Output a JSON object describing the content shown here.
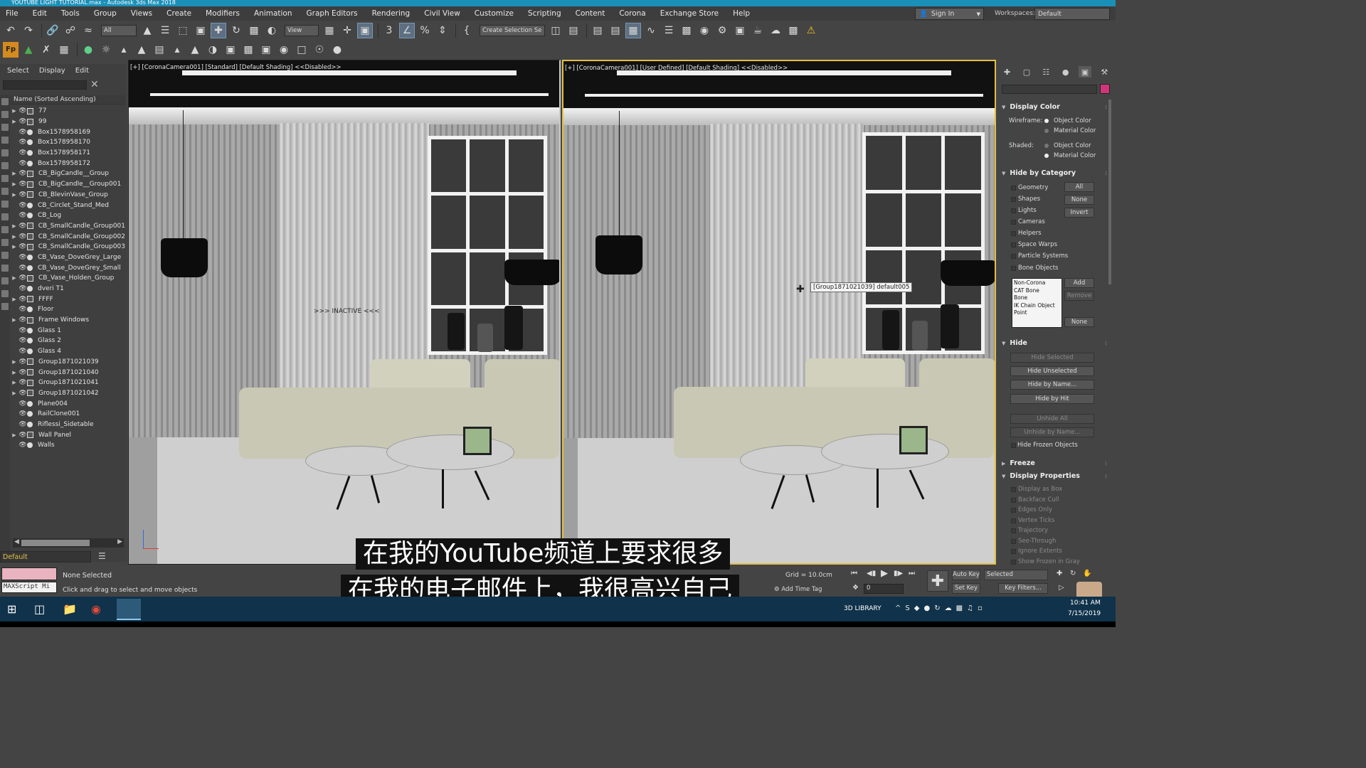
{
  "window": {
    "title": "YOUTUBE LIGHT TUTORIAL.max - Autodesk 3ds Max 2018"
  },
  "menu": [
    "File",
    "Edit",
    "Tools",
    "Group",
    "Views",
    "Create",
    "Modifiers",
    "Animation",
    "Graph Editors",
    "Rendering",
    "Civil View",
    "Customize",
    "Scripting",
    "Content",
    "Corona",
    "Exchange Store",
    "Help"
  ],
  "account": {
    "signin": "Sign In",
    "workspaces_label": "Workspaces:",
    "workspace": "Default"
  },
  "toolbar": {
    "filter": "All",
    "refcoord": "View",
    "selection_set": "Create Selection Se"
  },
  "explorer": {
    "tabs": [
      "Select",
      "Display",
      "Edit"
    ],
    "header": "Name (Sorted Ascending)",
    "items": [
      {
        "name": "77",
        "group": true
      },
      {
        "name": "99",
        "group": true
      },
      {
        "name": "Box1578958169",
        "group": false
      },
      {
        "name": "Box1578958170",
        "group": false
      },
      {
        "name": "Box1578958171",
        "group": false
      },
      {
        "name": "Box1578958172",
        "group": false
      },
      {
        "name": "CB_BigCandle__Group",
        "group": true
      },
      {
        "name": "CB_BigCandle__Group001",
        "group": true
      },
      {
        "name": "CB_BlevinVase_Group",
        "group": true
      },
      {
        "name": "CB_Circlet_Stand_Med",
        "group": false
      },
      {
        "name": "CB_Log",
        "group": false
      },
      {
        "name": "CB_SmallCandle_Group001",
        "group": true
      },
      {
        "name": "CB_SmallCandle_Group002",
        "group": true
      },
      {
        "name": "CB_SmallCandle_Group003",
        "group": true
      },
      {
        "name": "CB_Vase_DoveGrey_Large",
        "group": false
      },
      {
        "name": "CB_Vase_DoveGrey_Small",
        "group": false
      },
      {
        "name": "CB_Vase_Holden_Group",
        "group": true
      },
      {
        "name": "dveri T1",
        "group": false
      },
      {
        "name": "FFFF",
        "group": true
      },
      {
        "name": "Floor",
        "group": false
      },
      {
        "name": "Frame Windows",
        "group": true
      },
      {
        "name": "Glass 1",
        "group": false
      },
      {
        "name": "Glass 2",
        "group": false
      },
      {
        "name": "Glass 4",
        "group": false
      },
      {
        "name": "Group1871021039",
        "group": true
      },
      {
        "name": "Group1871021040",
        "group": true
      },
      {
        "name": "Group1871021041",
        "group": true
      },
      {
        "name": "Group1871021042",
        "group": true
      },
      {
        "name": "Plane004",
        "group": false
      },
      {
        "name": "RailClone001",
        "group": false
      },
      {
        "name": "Riflessi_Sidetable",
        "group": false
      },
      {
        "name": "Wall Panel",
        "group": true
      },
      {
        "name": "Walls",
        "group": false
      }
    ],
    "layer": "Default"
  },
  "viewports": {
    "left_label": "[+] [CoronaCamera001] [Standard] [Default Shading] <<Disabled>>",
    "right_label": "[+] [CoronaCamera001] [User Defined] [Default Shading] <<Disabled>>",
    "inactive": ">>> INACTIVE <<<",
    "tooltip": "[Group1871021039] default005"
  },
  "command_panel": {
    "display_color": {
      "title": "Display Color",
      "wireframe_label": "Wireframe:",
      "shaded_label": "Shaded:",
      "object_color": "Object Color",
      "material_color": "Material Color",
      "wireframe_selected": "Object Color",
      "shaded_selected": "Material Color"
    },
    "hide_by_category": {
      "title": "Hide by Category",
      "items": [
        "Geometry",
        "Shapes",
        "Lights",
        "Cameras",
        "Helpers",
        "Space Warps",
        "Particle Systems",
        "Bone Objects"
      ],
      "buttons": [
        "All",
        "None",
        "Invert"
      ],
      "list": [
        "Non-Corona",
        "CAT Bone",
        "Bone",
        "IK Chain Object",
        "Point"
      ],
      "list_buttons": [
        "Add",
        "Remove",
        "None"
      ]
    },
    "hide": {
      "title": "Hide",
      "buttons": [
        "Hide Selected",
        "Hide Unselected",
        "Hide by Name...",
        "Hide by Hit",
        "Unhide All",
        "Unhide by Name..."
      ],
      "frozen": "Hide Frozen Objects"
    },
    "freeze": {
      "title": "Freeze"
    },
    "display_properties": {
      "title": "Display Properties",
      "items": [
        "Display as Box",
        "Backface Cull",
        "Edges Only",
        "Vertex Ticks",
        "Trajectory",
        "See-Through",
        "Ignore Extents",
        "Show Frozen in Gray"
      ]
    }
  },
  "status": {
    "maxscript": "MAXScript Mi",
    "selection": "None Selected",
    "prompt": "Click and drag to select and move objects",
    "grid": "Grid = 10.0cm",
    "add_time_tag": "Add Time Tag",
    "frame": "0",
    "auto_key": "Auto Key",
    "set_key": "Set Key",
    "key_mode": "Selected",
    "key_filters": "Key Filters..."
  },
  "subtitles": {
    "line1": "在我的YouTube频道上要求很多",
    "line2": "在我的电子邮件上，我很高兴自己"
  },
  "taskbar": {
    "library": "3D LIBRARY",
    "time": "10:41 AM",
    "date": "7/15/2019"
  },
  "colors": {
    "title_bar": "#1a8fb8",
    "active_viewport_border": "#e2c040",
    "object_swatch": "#d0357a",
    "maxscript_listener": "#e9b3c0",
    "taskbar": "#10324a"
  }
}
